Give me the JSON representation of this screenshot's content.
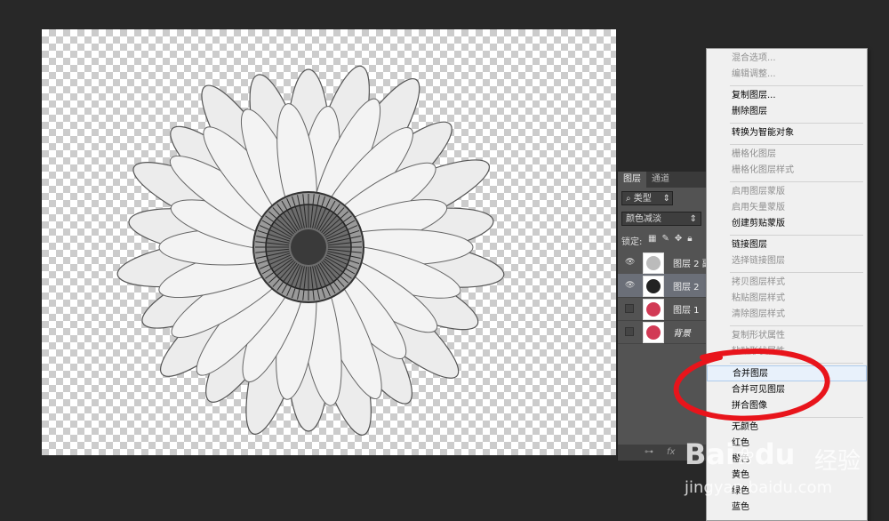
{
  "panel": {
    "tabs": [
      "图层",
      "通道"
    ],
    "filter_label": "类型",
    "blend_mode": "颜色减淡",
    "lock_label": "锁定:",
    "layers": [
      {
        "name": "图层 2 副",
        "visible": true
      },
      {
        "name": "图层 2",
        "visible": true
      },
      {
        "name": "图层 1",
        "visible": false
      },
      {
        "name": "背景",
        "visible": false
      }
    ],
    "bottom_icons": [
      "link-icon",
      "fx-icon"
    ],
    "fx_label": "fx"
  },
  "menu": {
    "items": [
      {
        "label": "混合选项...",
        "enabled": false
      },
      {
        "label": "编辑调整...",
        "enabled": false
      },
      {
        "label": "复制图层...",
        "enabled": true
      },
      {
        "label": "删除图层",
        "enabled": true
      },
      {
        "label": "转换为智能对象",
        "enabled": true
      },
      {
        "label": "栅格化图层",
        "enabled": false
      },
      {
        "label": "栅格化图层样式",
        "enabled": false
      },
      {
        "label": "启用图层蒙版",
        "enabled": false
      },
      {
        "label": "启用矢量蒙版",
        "enabled": false
      },
      {
        "label": "创建剪贴蒙版",
        "enabled": true
      },
      {
        "label": "链接图层",
        "enabled": true
      },
      {
        "label": "选择链接图层",
        "enabled": false
      },
      {
        "label": "拷贝图层样式",
        "enabled": false
      },
      {
        "label": "粘贴图层样式",
        "enabled": false
      },
      {
        "label": "清除图层样式",
        "enabled": false
      },
      {
        "label": "复制形状属性",
        "enabled": false
      },
      {
        "label": "粘贴形状属性",
        "enabled": false
      },
      {
        "label": "合并图层",
        "enabled": true,
        "highlighted": true
      },
      {
        "label": "合并可见图层",
        "enabled": true
      },
      {
        "label": "拼合图像",
        "enabled": true
      },
      {
        "label": "无颜色",
        "enabled": true
      },
      {
        "label": "红色",
        "enabled": true
      },
      {
        "label": "橙色",
        "enabled": true
      },
      {
        "label": "黄色",
        "enabled": true
      },
      {
        "label": "绿色",
        "enabled": true
      },
      {
        "label": "蓝色",
        "enabled": true
      }
    ]
  },
  "watermark": {
    "brand": "Bai",
    "brand_suffix": "du",
    "cn": "经验",
    "url": "jingyan.baidu.com"
  },
  "colors": {
    "background": "#282828",
    "panel": "#535353",
    "menu_bg": "#f0f0f0",
    "highlight": "#e8f1fb",
    "annotation": "#e8141b"
  }
}
